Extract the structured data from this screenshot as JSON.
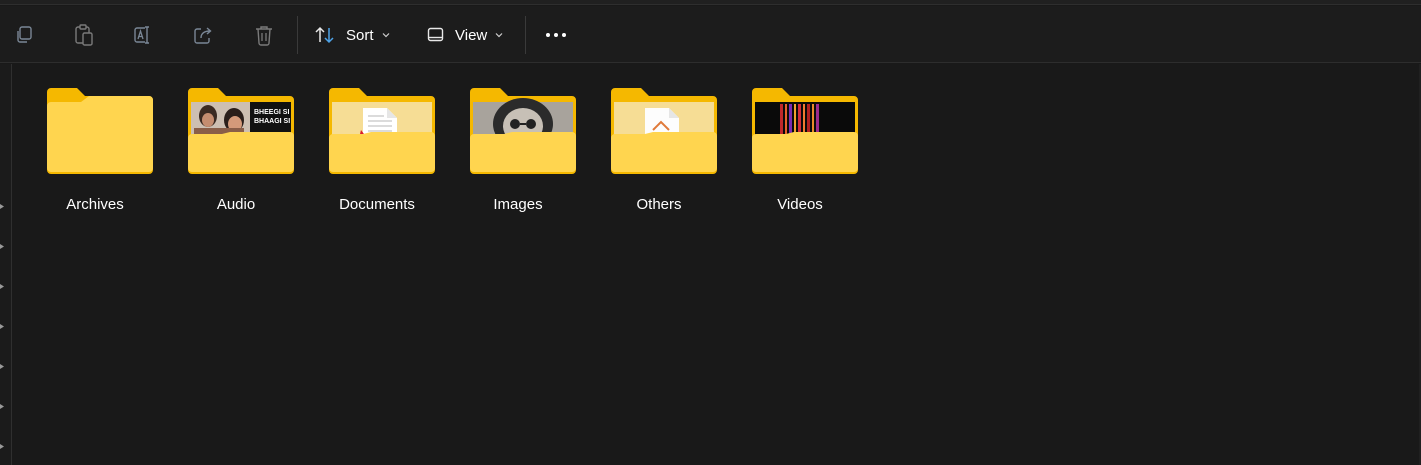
{
  "toolbar": {
    "copy_icon": "copy-icon",
    "paste_icon": "paste-icon",
    "rename_icon": "rename-icon",
    "share_icon": "share-icon",
    "delete_icon": "delete-icon",
    "sort_label": "Sort",
    "view_label": "View",
    "more_icon": "more-options-icon"
  },
  "folders": [
    {
      "name": "Archives",
      "preview": "none"
    },
    {
      "name": "Audio",
      "preview": "photo",
      "preview_text": "BHEEGI SI BHAAGI SI"
    },
    {
      "name": "Documents",
      "preview": "document"
    },
    {
      "name": "Images",
      "preview": "image"
    },
    {
      "name": "Others",
      "preview": "file"
    },
    {
      "name": "Videos",
      "preview": "video"
    }
  ],
  "colors": {
    "background": "#191919",
    "folder_front": "#ffd54f",
    "folder_back": "#f5b800",
    "accent": "#4ea3e8"
  }
}
